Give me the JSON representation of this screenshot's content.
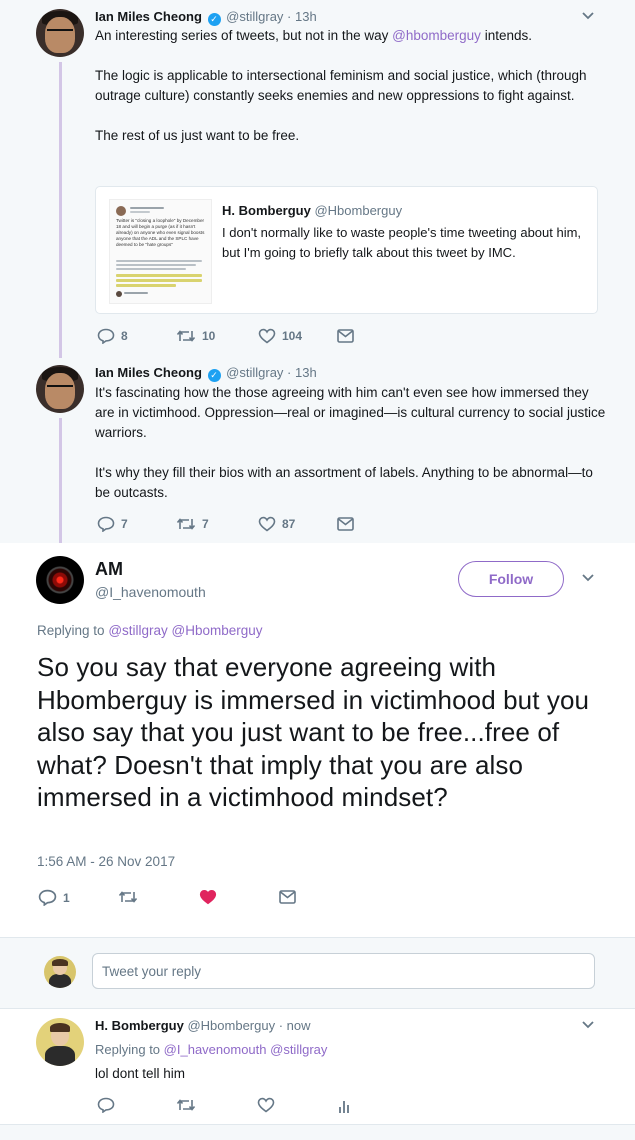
{
  "context": {
    "tweet1": {
      "name": "Ian Miles Cheong",
      "handle": "@stillgray",
      "time": "· 13h",
      "intro_pre": "An interesting series of tweets, but not in the way ",
      "intro_mention": "@hbomberguy",
      "intro_post": " intends.",
      "para2": "The logic is applicable to intersectional feminism and social justice, which (through outrage culture) constantly seeks enemies and new oppressions to fight against.",
      "para3": "The rest of us just want to be free.",
      "quote": {
        "name": "H. Bomberguy",
        "handle": "@Hbomberguy",
        "text": "I don't normally like to waste people's time tweeting about him, but I'm going to briefly talk about this tweet by IMC.",
        "image_caption": "Twitter is \"closing a loophole\" by December 18 and will begin a purge (as if it hasn't already) on anyone who even signal boosts anyone that the ADL and the SPLC have deemed to be \"hate groups\""
      },
      "replies": "8",
      "retweets": "10",
      "likes": "104"
    },
    "tweet2": {
      "name": "Ian Miles Cheong",
      "handle": "@stillgray",
      "time": "· 13h",
      "para1": "It's fascinating how the those agreeing with him can't even see how immersed they are in victimhood. Oppression—real or imagined—is cultural currency to social justice warriors.",
      "para2": "It's why they fill their bios with an assortment of labels. Anything to be abnormal—to be outcasts.",
      "replies": "7",
      "retweets": "7",
      "likes": "87"
    }
  },
  "main": {
    "name": "AM",
    "handle": "@I_havenomouth",
    "follow_label": "Follow",
    "replying_to_label": "Replying to",
    "replying_to_1": "@stillgray",
    "replying_to_2": "@Hbomberguy",
    "text": "So you say that everyone agreeing with Hbomberguy is immersed in victimhood but you also say that you just want to be free...free of what? Doesn't that imply that you are also immersed in a victimhood mindset?",
    "timestamp": "1:56 AM - 26 Nov 2017",
    "replies": "1",
    "liked": true,
    "like_color": "#e0245e"
  },
  "reply_box": {
    "placeholder": "Tweet your reply"
  },
  "reply": {
    "name": "H. Bomberguy",
    "handle": "@Hbomberguy",
    "time": "· now",
    "replying_to_label": "Replying to",
    "replying_to_1": "@I_havenomouth",
    "replying_to_2": "@stillgray",
    "text": "lol dont tell him"
  },
  "colors": {
    "accent": "#8f6ac8",
    "icon": "#657786",
    "verified": "#1da1f2"
  }
}
